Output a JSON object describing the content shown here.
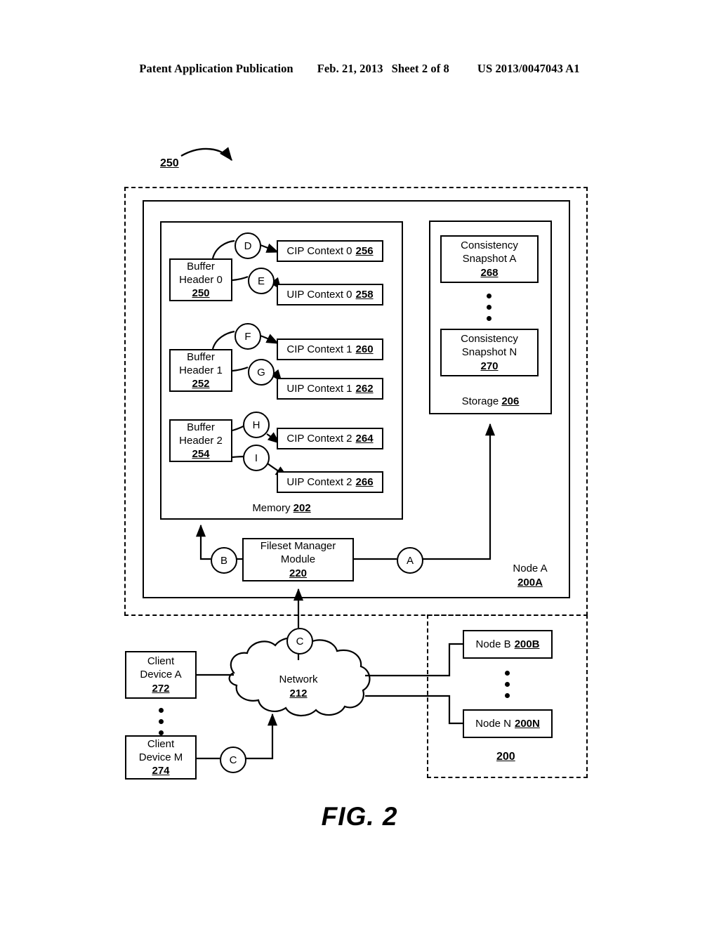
{
  "header": {
    "publication": "Patent Application Publication",
    "date": "Feb. 21, 2013",
    "sheet": "Sheet 2 of 8",
    "patent_number": "US 2013/0047043 A1"
  },
  "figure": {
    "caption": "FIG. 2",
    "callout_250": "250",
    "system_ref": "200"
  },
  "node_a": {
    "label": "Node A",
    "ref": "200A"
  },
  "memory": {
    "label": "Memory",
    "ref": "202",
    "buffer_headers": [
      {
        "line1": "Buffer",
        "line2": "Header 0",
        "ref": "250"
      },
      {
        "line1": "Buffer",
        "line2": "Header 1",
        "ref": "252"
      },
      {
        "line1": "Buffer",
        "line2": "Header 2",
        "ref": "254"
      }
    ],
    "contexts": [
      {
        "label": "CIP Context 0",
        "ref": "256"
      },
      {
        "label": "UIP Context 0",
        "ref": "258"
      },
      {
        "label": "CIP Context 1",
        "ref": "260"
      },
      {
        "label": "UIP Context 1",
        "ref": "262"
      },
      {
        "label": "CIP Context 2",
        "ref": "264"
      },
      {
        "label": "UIP Context 2",
        "ref": "266"
      }
    ],
    "connectors": [
      "D",
      "E",
      "F",
      "G",
      "H",
      "I"
    ]
  },
  "storage": {
    "label": "Storage",
    "ref": "206",
    "snapshots": [
      {
        "line1": "Consistency",
        "line2": "Snapshot A",
        "ref": "268"
      },
      {
        "line1": "Consistency",
        "line2": "Snapshot N",
        "ref": "270"
      }
    ]
  },
  "fileset_manager": {
    "line1": "Fileset Manager",
    "line2": "Module",
    "ref": "220"
  },
  "connectors": {
    "a": "A",
    "b": "B",
    "c_top": "C",
    "c_bottom": "C"
  },
  "network": {
    "label": "Network",
    "ref": "212"
  },
  "clients": [
    {
      "line1": "Client",
      "line2": "Device A",
      "ref": "272"
    },
    {
      "line1": "Client",
      "line2": "Device M",
      "ref": "274"
    }
  ],
  "nodes": [
    {
      "label": "Node B",
      "ref": "200B"
    },
    {
      "label": "Node N",
      "ref": "200N"
    }
  ]
}
